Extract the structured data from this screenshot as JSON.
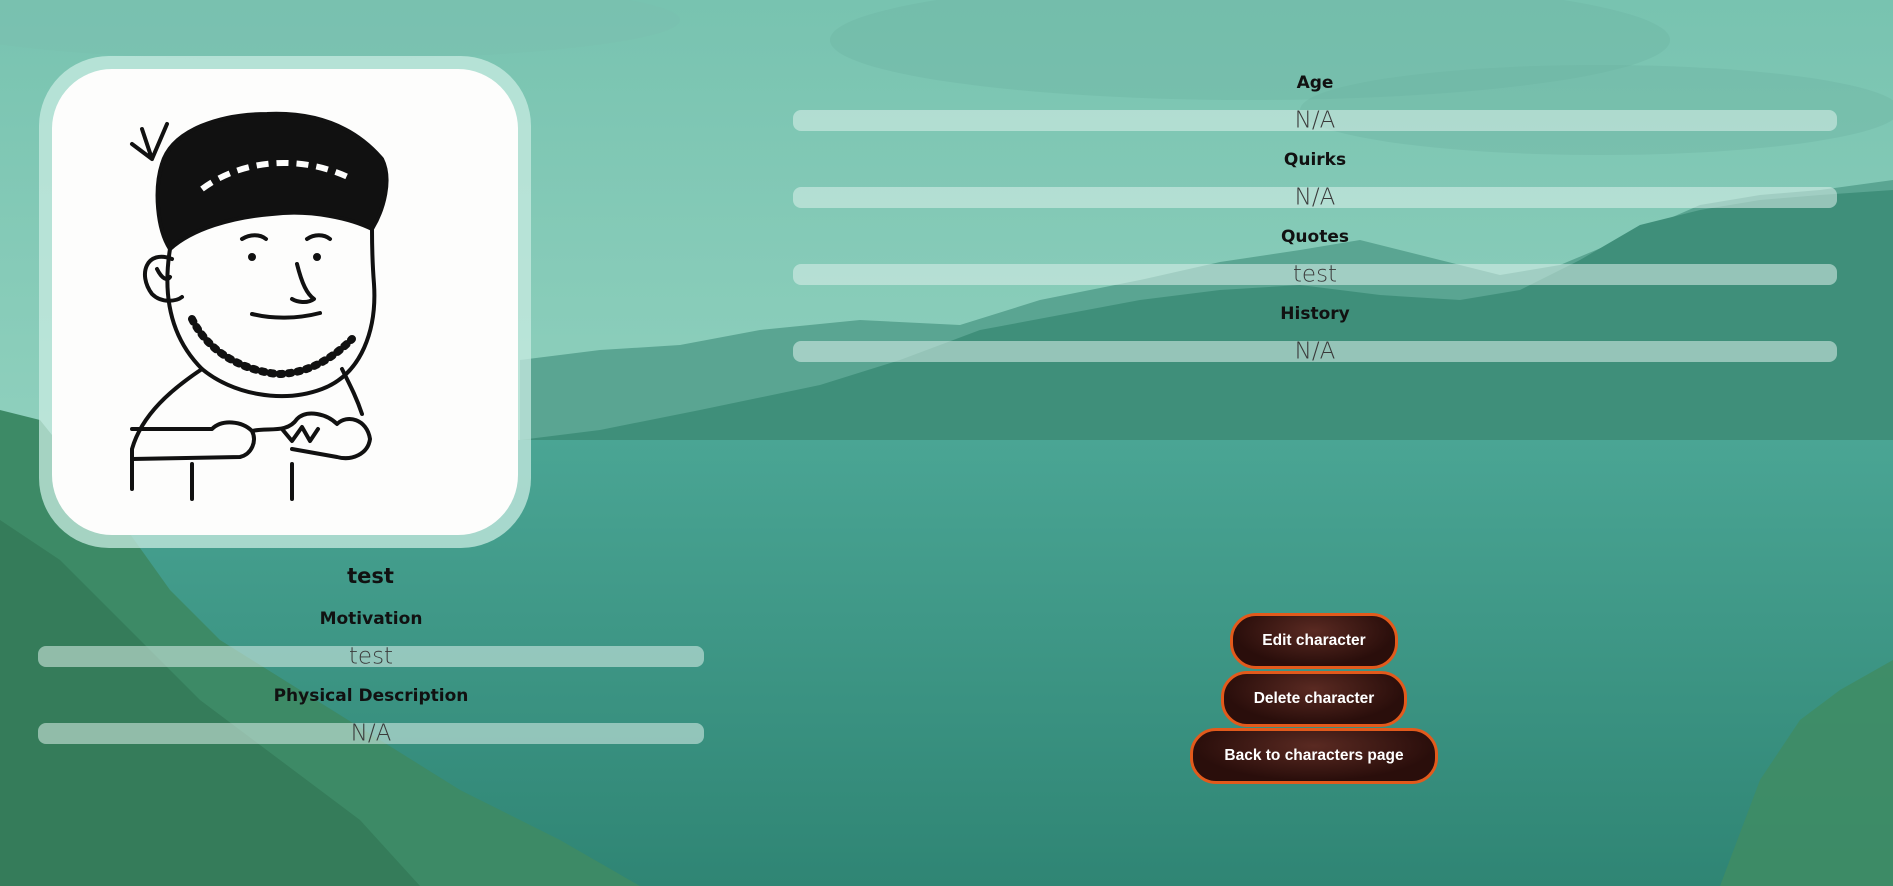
{
  "character": {
    "name": "test",
    "avatar_icon": "character-sketch-icon"
  },
  "left_fields": [
    {
      "label": "Motivation",
      "value": "test"
    },
    {
      "label": "Physical Description",
      "value": "N/A"
    }
  ],
  "right_fields": [
    {
      "label": "Age",
      "value": "N/A"
    },
    {
      "label": "Quirks",
      "value": "N/A"
    },
    {
      "label": "Quotes",
      "value": "test"
    },
    {
      "label": "History",
      "value": "N/A"
    }
  ],
  "buttons": {
    "edit": "Edit character",
    "delete": "Delete character",
    "back": "Back to characters page"
  },
  "colors": {
    "button_border": "#e25a1c",
    "button_fill": "#2a0e0b",
    "background": "#5aa99a"
  }
}
